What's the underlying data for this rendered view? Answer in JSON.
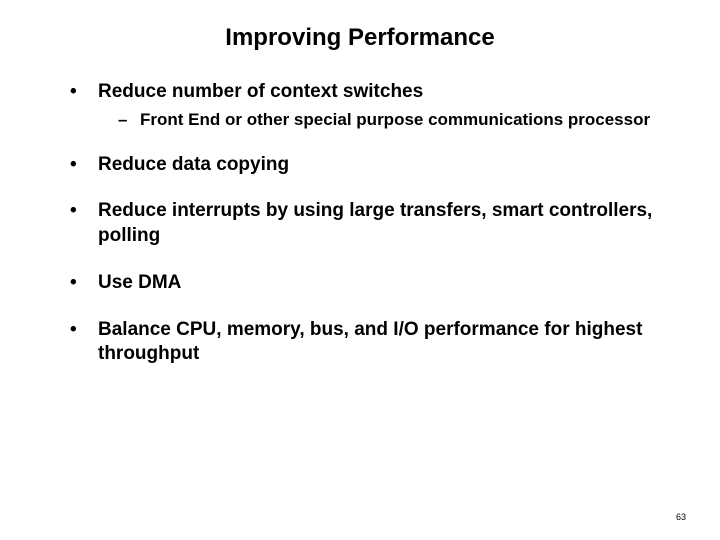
{
  "slide": {
    "title": "Improving Performance",
    "bullets": [
      {
        "text": "Reduce number of context switches",
        "sub": [
          "Front End or other special purpose communications processor"
        ]
      },
      {
        "text": "Reduce data copying"
      },
      {
        "text": "Reduce interrupts by using large transfers, smart controllers, polling"
      },
      {
        "text": "Use DMA"
      },
      {
        "text": "Balance CPU, memory, bus, and I/O performance for highest throughput"
      }
    ],
    "page_number": "63"
  }
}
